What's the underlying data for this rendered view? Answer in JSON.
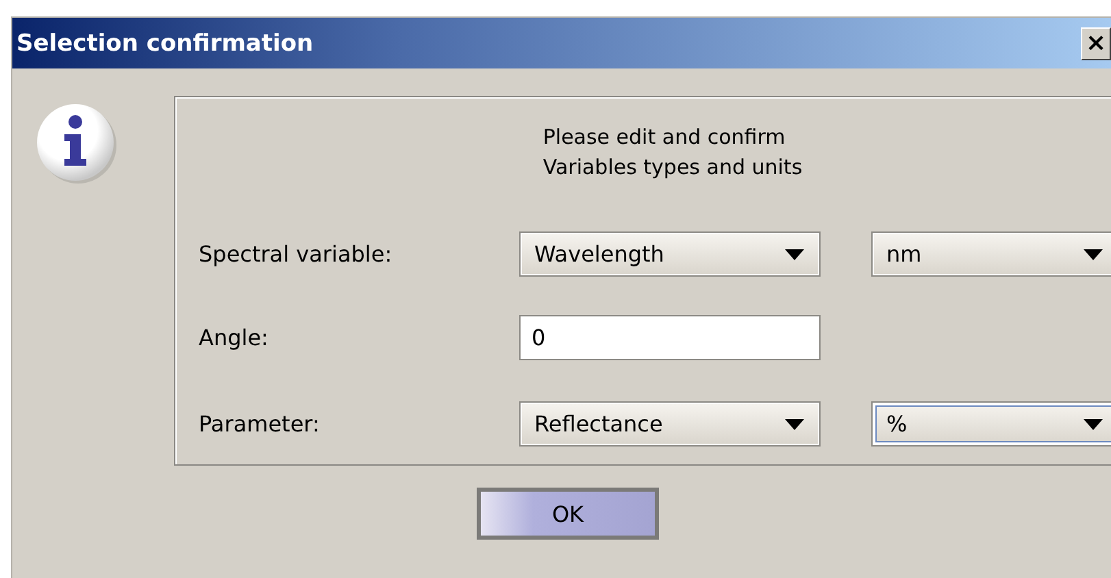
{
  "window": {
    "title": "Selection confirmation",
    "close": "×"
  },
  "message": [
    "Please edit and confirm",
    "Variables types and units"
  ],
  "rows": [
    {
      "label": "Spectral variable:",
      "kind": "combo-pair",
      "value": "Wavelength",
      "unit": "nm",
      "unit_focused": false
    },
    {
      "label": "Angle:",
      "kind": "field",
      "value": "0"
    },
    {
      "label": "Parameter:",
      "kind": "combo-pair",
      "value": "Reflectance",
      "unit": "%",
      "unit_focused": true
    }
  ],
  "buttons": [
    "OK"
  ]
}
